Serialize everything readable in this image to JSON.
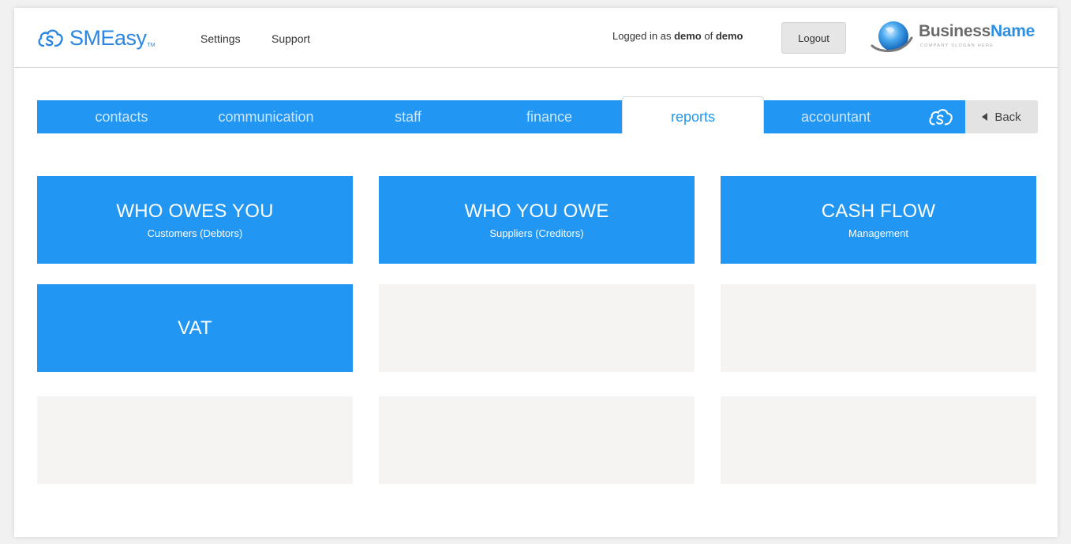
{
  "header": {
    "brand": "SMEasy",
    "brand_tm": "TM",
    "nav": [
      "Settings",
      "Support"
    ],
    "login_prefix": "Logged in as ",
    "user": "demo",
    "login_mid": " of ",
    "org": "demo",
    "logout_label": "Logout",
    "business_name_1": "Business",
    "business_name_2": "Name",
    "business_slogan": "COMPANY SLOGAN HERE"
  },
  "tabs": [
    {
      "label": "contacts",
      "active": false
    },
    {
      "label": "communication",
      "active": false
    },
    {
      "label": "staff",
      "active": false
    },
    {
      "label": "finance",
      "active": false
    },
    {
      "label": "reports",
      "active": true
    },
    {
      "label": "accountant",
      "active": false
    }
  ],
  "back_label": "Back",
  "tiles": [
    {
      "title": "WHO OWES YOU",
      "subtitle": "Customers (Debtors)"
    },
    {
      "title": "WHO YOU OWE",
      "subtitle": "Suppliers (Creditors)"
    },
    {
      "title": "CASH FLOW",
      "subtitle": "Management"
    },
    {
      "title": "VAT",
      "subtitle": ""
    }
  ],
  "colors": {
    "primary": "#2196f3",
    "brand": "#2a86e0",
    "empty_tile": "#f6f3f3"
  },
  "icons": [
    "smeasy-cloud-icon",
    "globe-logo-icon",
    "cloud-icon",
    "back-arrow-icon"
  ]
}
